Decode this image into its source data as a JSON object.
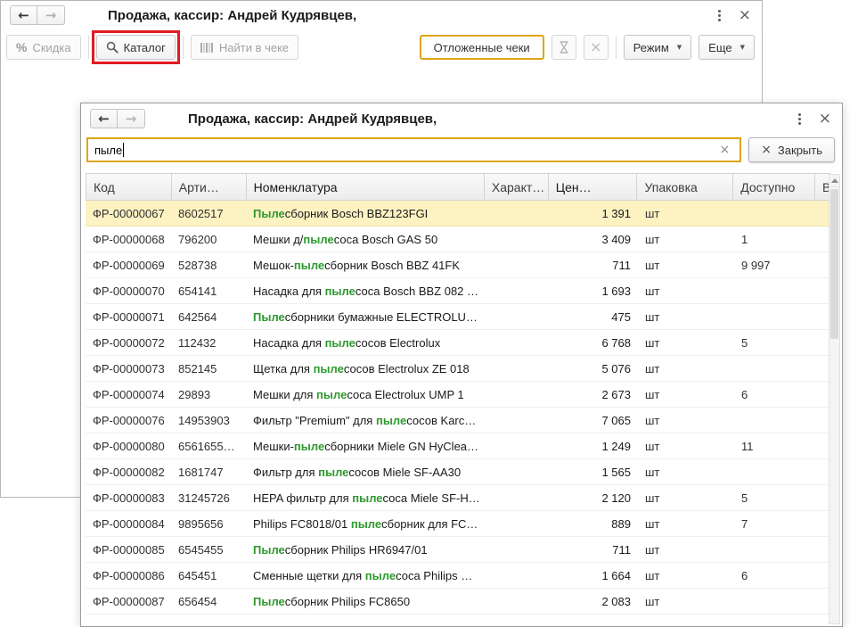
{
  "colors": {
    "accent_yellow": "#dfa414",
    "match_green": "#2e9a2e",
    "selected_row": "#fdf2c2",
    "annotation_red": "#e11b22"
  },
  "icons": {
    "back": "←",
    "forward": "→",
    "close": "×",
    "dropdown": "▼",
    "clear": "×",
    "percent": "%"
  },
  "main_window": {
    "title": "Продажа, кассир: Андрей Кудрявцев,",
    "toolbar": {
      "discount_label": "Скидка",
      "catalog_label": "Каталог",
      "find_in_receipt_label": "Найти в чеке",
      "deferred_receipts_label": "Отложенные чеки",
      "mode_label": "Режим",
      "more_label": "Еще"
    }
  },
  "catalog_window": {
    "title": "Продажа, кассир: Андрей Кудрявцев,",
    "search": {
      "query": "пыле"
    },
    "close_label": "Закрыть",
    "table": {
      "columns": [
        "Код",
        "Арти…",
        "Номенклатура",
        "Характ…",
        "Цен…",
        "Упаковка",
        "Доступно",
        "В"
      ],
      "rows": [
        {
          "code": "ФР-00000067",
          "article": "8602517",
          "name": "Пылесборник Bosch BBZ123FGI",
          "characteristic": "",
          "price": "1 391",
          "pack": "шт",
          "available": "",
          "selected": true
        },
        {
          "code": "ФР-00000068",
          "article": "796200",
          "name": "Мешки д/пылесоса Bosch GAS 50",
          "characteristic": "",
          "price": "3 409",
          "pack": "шт",
          "available": "1",
          "selected": false
        },
        {
          "code": "ФР-00000069",
          "article": "528738",
          "name": "Мешок-пылесборник Bosch BBZ 41FK",
          "characteristic": "",
          "price": "711",
          "pack": "шт",
          "available": "9 997",
          "selected": false
        },
        {
          "code": "ФР-00000070",
          "article": "654141",
          "name": "Насадка для пылесоса Bosch BBZ 082 …",
          "characteristic": "",
          "price": "1 693",
          "pack": "шт",
          "available": "",
          "selected": false
        },
        {
          "code": "ФР-00000071",
          "article": "642564",
          "name": "Пылесборники бумажные ELECTROLU…",
          "characteristic": "",
          "price": "475",
          "pack": "шт",
          "available": "",
          "selected": false
        },
        {
          "code": "ФР-00000072",
          "article": "112432",
          "name": "Насадка для пылесосов Electrolux",
          "characteristic": "",
          "price": "6 768",
          "pack": "шт",
          "available": "5",
          "selected": false
        },
        {
          "code": "ФР-00000073",
          "article": "852145",
          "name": "Щетка для пылесосов Electrolux ZE 018",
          "characteristic": "",
          "price": "5 076",
          "pack": "шт",
          "available": "",
          "selected": false
        },
        {
          "code": "ФР-00000074",
          "article": "29893",
          "name": "Мешки для пылесоса Electrolux UMP 1",
          "characteristic": "",
          "price": "2 673",
          "pack": "шт",
          "available": "6",
          "selected": false
        },
        {
          "code": "ФР-00000076",
          "article": "14953903",
          "name": "Фильтр \"Premium\" для пылесосов Karc…",
          "characteristic": "",
          "price": "7 065",
          "pack": "шт",
          "available": "",
          "selected": false
        },
        {
          "code": "ФР-00000080",
          "article": "6561655…",
          "name": "Мешки-пылесборники Miele GN HyClea…",
          "characteristic": "",
          "price": "1 249",
          "pack": "шт",
          "available": "11",
          "selected": false
        },
        {
          "code": "ФР-00000082",
          "article": "1681747",
          "name": "Фильтр для пылесосов Miele SF-AA30",
          "characteristic": "",
          "price": "1 565",
          "pack": "шт",
          "available": "",
          "selected": false
        },
        {
          "code": "ФР-00000083",
          "article": "31245726",
          "name": "HEPA фильтр для пылесоса Miele SF-H…",
          "characteristic": "",
          "price": "2 120",
          "pack": "шт",
          "available": "5",
          "selected": false
        },
        {
          "code": "ФР-00000084",
          "article": "9895656",
          "name": "Philips FC8018/01 пылесборник для FC…",
          "characteristic": "",
          "price": "889",
          "pack": "шт",
          "available": "7",
          "selected": false
        },
        {
          "code": "ФР-00000085",
          "article": "6545455",
          "name": "Пылесборник Philips HR6947/01",
          "characteristic": "",
          "price": "711",
          "pack": "шт",
          "available": "",
          "selected": false
        },
        {
          "code": "ФР-00000086",
          "article": "645451",
          "name": "Сменные щетки для пылесоса Philips …",
          "characteristic": "",
          "price": "1 664",
          "pack": "шт",
          "available": "6",
          "selected": false
        },
        {
          "code": "ФР-00000087",
          "article": "656454",
          "name": "Пылесборник Philips FC8650",
          "characteristic": "",
          "price": "2 083",
          "pack": "шт",
          "available": "",
          "selected": false
        }
      ]
    }
  }
}
